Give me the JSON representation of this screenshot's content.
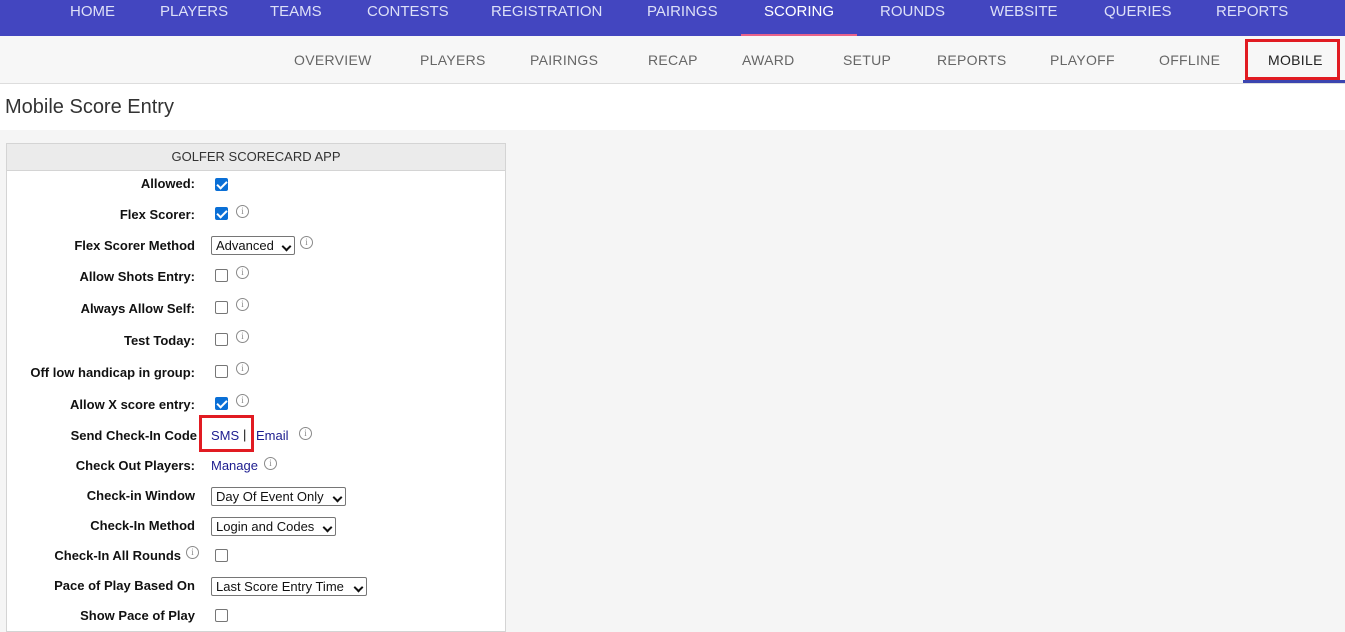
{
  "top_nav": [
    {
      "label": "HOME",
      "active": false
    },
    {
      "label": "PLAYERS",
      "active": false
    },
    {
      "label": "TEAMS",
      "active": false
    },
    {
      "label": "CONTESTS",
      "active": false
    },
    {
      "label": "REGISTRATION",
      "active": false
    },
    {
      "label": "PAIRINGS",
      "active": false
    },
    {
      "label": "SCORING",
      "active": true
    },
    {
      "label": "ROUNDS",
      "active": false
    },
    {
      "label": "WEBSITE",
      "active": false
    },
    {
      "label": "QUERIES",
      "active": false
    },
    {
      "label": "REPORTS",
      "active": false
    }
  ],
  "sub_nav": [
    {
      "label": "OVERVIEW",
      "active": false
    },
    {
      "label": "PLAYERS",
      "active": false
    },
    {
      "label": "PAIRINGS",
      "active": false
    },
    {
      "label": "RECAP",
      "active": false
    },
    {
      "label": "AWARD",
      "active": false
    },
    {
      "label": "SETUP",
      "active": false
    },
    {
      "label": "REPORTS",
      "active": false
    },
    {
      "label": "PLAYOFF",
      "active": false
    },
    {
      "label": "OFFLINE",
      "active": false
    },
    {
      "label": "MOBILE",
      "active": true
    }
  ],
  "page_title": "Mobile Score Entry",
  "panel": {
    "header": "GOLFER SCORECARD APP",
    "fields": {
      "allowed": {
        "label": "Allowed:",
        "checked": true
      },
      "flex_scorer": {
        "label": "Flex Scorer:",
        "checked": true
      },
      "flex_scorer_method": {
        "label": "Flex Scorer Method",
        "value": "Advanced"
      },
      "allow_shots_entry": {
        "label": "Allow Shots Entry:",
        "checked": false
      },
      "always_allow_self": {
        "label": "Always Allow Self:",
        "checked": false
      },
      "test_today": {
        "label": "Test Today:",
        "checked": false
      },
      "off_low_handicap": {
        "label": "Off low handicap in group:",
        "checked": false
      },
      "allow_x_score": {
        "label": "Allow X score entry:",
        "checked": true
      },
      "send_check_in_code": {
        "label": "Send Check-In Code",
        "sms": "SMS",
        "separator": "|",
        "email": "Email"
      },
      "check_out_players": {
        "label": "Check Out Players:",
        "link": "Manage"
      },
      "check_in_window": {
        "label": "Check-in Window",
        "value": "Day Of Event Only"
      },
      "check_in_method": {
        "label": "Check-In Method",
        "value": "Login and Codes"
      },
      "check_in_all_rounds": {
        "label": "Check-In All Rounds",
        "checked": false
      },
      "pace_of_play_based_on": {
        "label": "Pace of Play Based On",
        "value": "Last Score Entry Time"
      },
      "show_pace_of_play": {
        "label": "Show Pace of Play",
        "checked": false
      }
    }
  },
  "info_glyph": "i",
  "colors": {
    "nav_bg": "#4346c0",
    "accent": "#e11b22",
    "link": "#1c1c8f",
    "checkbox": "#0a6fd6"
  }
}
